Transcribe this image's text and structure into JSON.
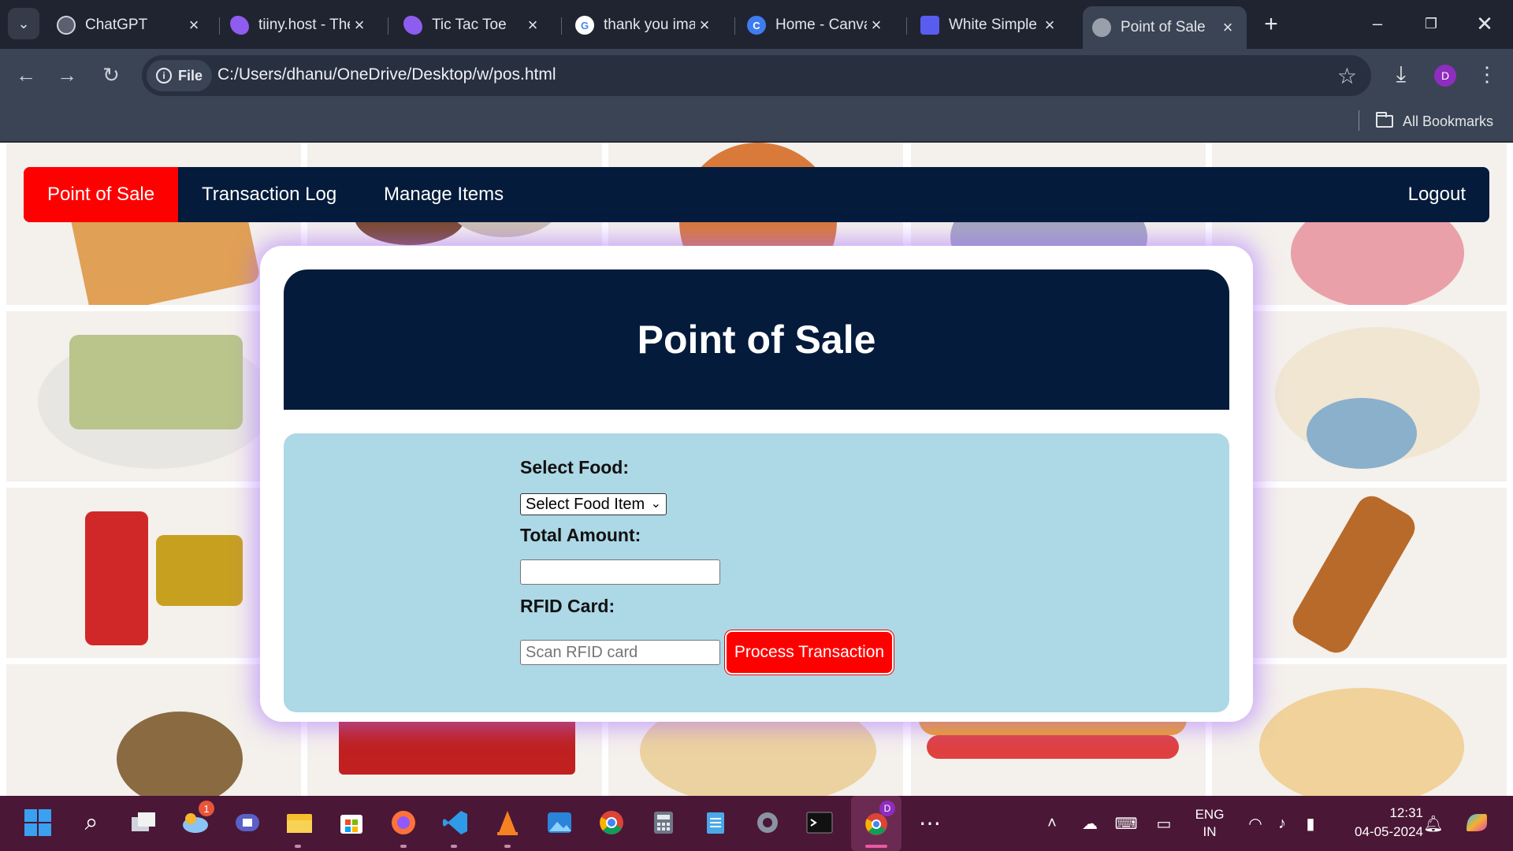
{
  "browser": {
    "tabs": [
      {
        "title": "ChatGPT",
        "icon": "openai-icon",
        "color": "#cfd3da"
      },
      {
        "title": "tiiny.host - The",
        "icon": "tiiny-host-icon",
        "color": "#8f5cf0"
      },
      {
        "title": "Tic Tac Toe",
        "icon": "tiiny-host-icon",
        "color": "#8f5cf0"
      },
      {
        "title": "thank you ima",
        "icon": "google-icon",
        "color": "#ffffff"
      },
      {
        "title": "Home - Canva",
        "icon": "canva-icon",
        "color": "#3f7cf0"
      },
      {
        "title": "White Simple",
        "icon": "document-icon",
        "color": "#5a5cf0"
      },
      {
        "title": "Point of Sale",
        "icon": "globe-icon",
        "color": "#9aa0ab"
      }
    ],
    "active_tab_index": 6,
    "address": {
      "chip_label": "File",
      "url": "C:/Users/dhanu/OneDrive/Desktop/w/pos.html"
    },
    "profile_initial": "D",
    "bookmarks_label": "All Bookmarks"
  },
  "page": {
    "nav": {
      "items": [
        {
          "label": "Point of Sale",
          "active": true
        },
        {
          "label": "Transaction Log",
          "active": false
        },
        {
          "label": "Manage Items",
          "active": false
        }
      ],
      "logout_label": "Logout"
    },
    "title": "Point of Sale",
    "form": {
      "food_label": "Select Food:",
      "food_select_value": "Select Food Item",
      "amount_label": "Total Amount:",
      "amount_value": "",
      "rfid_label": "RFID Card:",
      "rfid_placeholder": "Scan RFID card",
      "process_button": "Process Transaction"
    },
    "colors": {
      "navbar": "#041b3b",
      "accent": "#ff0000",
      "form_panel": "#add8e6"
    }
  },
  "taskbar": {
    "notification_badge": "1",
    "language": "ENG",
    "region": "IN",
    "time": "12:31",
    "date": "04-05-2024",
    "apps": [
      "windows-start-icon",
      "search-icon",
      "task-view-icon",
      "widgets-icon",
      "teams-icon",
      "file-explorer-icon",
      "microsoft-store-icon",
      "firefox-icon",
      "vscode-icon",
      "vlc-icon",
      "photos-icon",
      "chrome-icon",
      "calculator-icon",
      "notepad-icon",
      "settings-icon",
      "terminal-icon",
      "chrome-profile-icon",
      "more-icon"
    ]
  }
}
